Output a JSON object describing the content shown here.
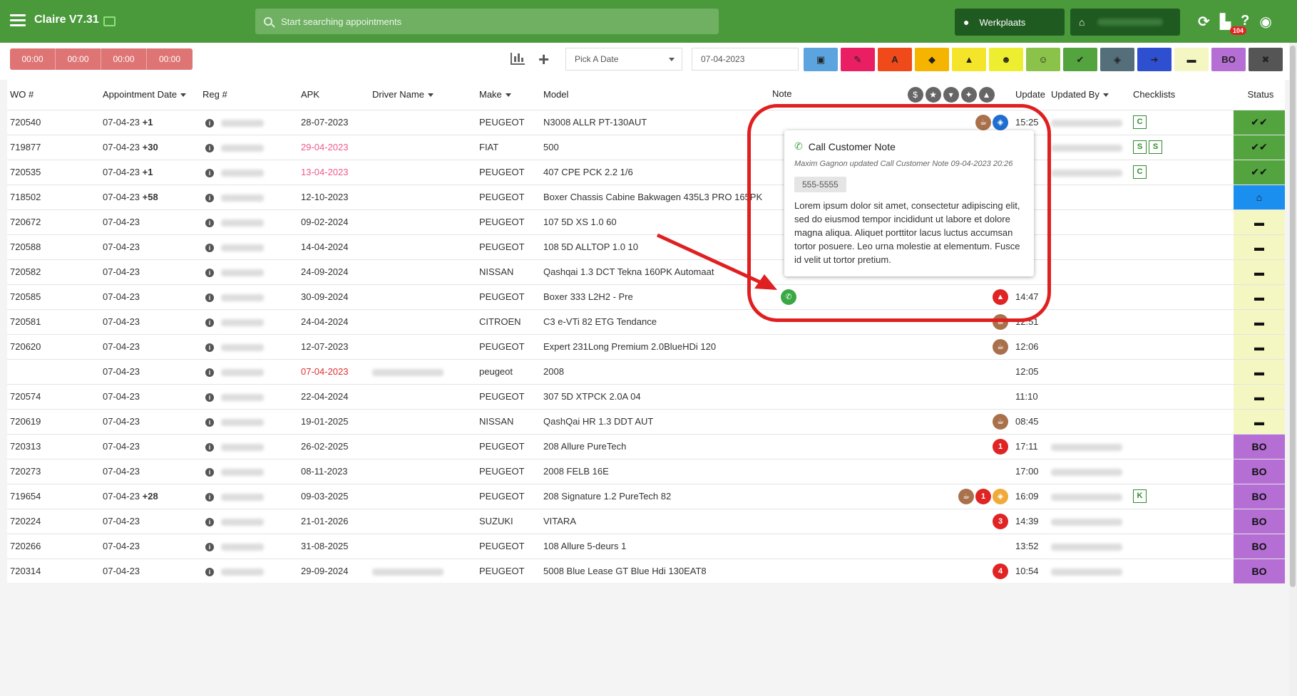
{
  "app": {
    "title": "Claire V7.31"
  },
  "search": {
    "placeholder": "Start searching appointments"
  },
  "location": {
    "label": "Werkplaats"
  },
  "badges": {
    "notifications": "104"
  },
  "timers": [
    "00:00",
    "00:00",
    "00:00",
    "00:00"
  ],
  "toolbar": {
    "pick_date_label": "Pick A Date",
    "date_value": "07-04-2023"
  },
  "filters": [
    {
      "icon": "calendar-icon",
      "glyph": "▣",
      "color": "#5ba4e0"
    },
    {
      "icon": "wrench-icon",
      "glyph": "✎",
      "color": "#e91e63"
    },
    {
      "icon": "font-a-icon",
      "glyph": "A",
      "color": "#f04a1a"
    },
    {
      "icon": "tag-icon",
      "glyph": "◆",
      "color": "#f4b400"
    },
    {
      "icon": "warning-icon",
      "glyph": "▲",
      "color": "#f5e52a"
    },
    {
      "icon": "user-check-icon",
      "glyph": "☻",
      "color": "#eeee30"
    },
    {
      "icon": "smile-icon",
      "glyph": "☺",
      "color": "#8bc34a"
    },
    {
      "icon": "double-check-icon",
      "glyph": "✔",
      "color": "#53a43f"
    },
    {
      "icon": "shield-icon",
      "glyph": "◈",
      "color": "#546e7a"
    },
    {
      "icon": "sign-out-icon",
      "glyph": "➜",
      "color": "#2e4fd0"
    },
    {
      "icon": "car-icon",
      "glyph": "▬",
      "color": "#f4f7c2"
    },
    {
      "icon": "bo-label",
      "glyph": "BO",
      "color": "#b46ed4"
    },
    {
      "icon": "close-circle-icon",
      "glyph": "✖",
      "color": "#555555"
    }
  ],
  "columns": {
    "wo": "WO #",
    "appointment_date": "Appointment Date",
    "reg": "Reg #",
    "apk": "APK",
    "driver": "Driver Name",
    "make": "Make",
    "model": "Model",
    "note": "Note",
    "update": "Update",
    "updated_by": "Updated By",
    "checklists": "Checklists",
    "status": "Status"
  },
  "rows": [
    {
      "wo": "720540",
      "date": "07-04-23",
      "plus": "+1",
      "apk": "28-07-2023",
      "apk_color": "",
      "make": "PEUGEOT",
      "model": "N3008 ALLR PT-130AUT",
      "update": "15:25",
      "checklists": [
        "C"
      ],
      "status": "check",
      "status_class": "st-green",
      "note_icons": [
        {
          "c": "brown",
          "t": "☕"
        },
        {
          "c": "blue",
          "t": "◈"
        }
      ],
      "updated_by_blur": true,
      "driver_blur": false
    },
    {
      "wo": "719877",
      "date": "07-04-23",
      "plus": "+30",
      "apk": "29-04-2023",
      "apk_color": "pink",
      "make": "FIAT",
      "model": "500",
      "update": "",
      "checklists": [
        "S",
        "S"
      ],
      "status": "check",
      "status_class": "st-green",
      "note_icons": [],
      "updated_by_blur": true,
      "driver_blur": false
    },
    {
      "wo": "720535",
      "date": "07-04-23",
      "plus": "+1",
      "apk": "13-04-2023",
      "apk_color": "pink",
      "make": "PEUGEOT",
      "model": "407 CPE PCK 2.2 1/6",
      "update": "",
      "checklists": [
        "C"
      ],
      "status": "check",
      "status_class": "st-green",
      "note_icons": [],
      "updated_by_blur": true,
      "driver_blur": false
    },
    {
      "wo": "718502",
      "date": "07-04-23",
      "plus": "+58",
      "apk": "12-10-2023",
      "apk_color": "",
      "make": "PEUGEOT",
      "model": "Boxer Chassis Cabine Bakwagen 435L3 PRO 165PK",
      "update": "",
      "checklists": [],
      "status": "garage",
      "status_class": "st-blue",
      "note_icons": [],
      "updated_by_blur": false,
      "driver_blur": false
    },
    {
      "wo": "720672",
      "date": "07-04-23",
      "plus": "",
      "apk": "09-02-2024",
      "apk_color": "",
      "make": "PEUGEOT",
      "model": "107 5D XS 1.0 60",
      "update": "",
      "checklists": [],
      "status": "car",
      "status_class": "st-yellow",
      "note_icons": [],
      "updated_by_blur": false,
      "driver_blur": false
    },
    {
      "wo": "720588",
      "date": "07-04-23",
      "plus": "",
      "apk": "14-04-2024",
      "apk_color": "",
      "make": "PEUGEOT",
      "model": "108 5D ALLTOP 1.0 10",
      "update": "",
      "checklists": [],
      "status": "car",
      "status_class": "st-yellow",
      "note_icons": [],
      "updated_by_blur": false,
      "driver_blur": false
    },
    {
      "wo": "720582",
      "date": "07-04-23",
      "plus": "",
      "apk": "24-09-2024",
      "apk_color": "",
      "make": "NISSAN",
      "model": "Qashqai 1.3 DCT Tekna 160PK Automaat",
      "update": "",
      "checklists": [],
      "status": "car",
      "status_class": "st-yellow",
      "note_icons": [],
      "updated_by_blur": false,
      "driver_blur": false
    },
    {
      "wo": "720585",
      "date": "07-04-23",
      "plus": "",
      "apk": "30-09-2024",
      "apk_color": "",
      "make": "PEUGEOT",
      "model": "Boxer 333 L2H2 - Pre",
      "update": "14:47",
      "checklists": [],
      "status": "car",
      "status_class": "st-yellow",
      "note_icons": [
        {
          "c": "red",
          "t": "▲"
        }
      ],
      "updated_by_blur": false,
      "driver_blur": false,
      "phone": true
    },
    {
      "wo": "720581",
      "date": "07-04-23",
      "plus": "",
      "apk": "24-04-2024",
      "apk_color": "",
      "make": "CITROEN",
      "model": "C3 e-VTi 82 ETG Tendance",
      "update": "12:51",
      "checklists": [],
      "status": "car",
      "status_class": "st-yellow",
      "note_icons": [
        {
          "c": "brown",
          "t": "☕"
        }
      ],
      "updated_by_blur": false,
      "driver_blur": false
    },
    {
      "wo": "720620",
      "date": "07-04-23",
      "plus": "",
      "apk": "12-07-2023",
      "apk_color": "",
      "make": "PEUGEOT",
      "model": "Expert 231Long Premium 2.0BlueHDi 120",
      "update": "12:06",
      "checklists": [],
      "status": "car",
      "status_class": "st-yellow",
      "note_icons": [
        {
          "c": "brown",
          "t": "☕"
        }
      ],
      "updated_by_blur": false,
      "driver_blur": false
    },
    {
      "wo": "",
      "date": "07-04-23",
      "plus": "",
      "apk": "07-04-2023",
      "apk_color": "red",
      "make": "peugeot",
      "model": "2008",
      "update": "12:05",
      "checklists": [],
      "status": "car",
      "status_class": "st-yellow",
      "note_icons": [],
      "updated_by_blur": false,
      "driver_blur": true
    },
    {
      "wo": "720574",
      "date": "07-04-23",
      "plus": "",
      "apk": "22-04-2024",
      "apk_color": "",
      "make": "PEUGEOT",
      "model": "307 5D XTPCK 2.0A 04",
      "update": "11:10",
      "checklists": [],
      "status": "car",
      "status_class": "st-yellow",
      "note_icons": [],
      "updated_by_blur": false,
      "driver_blur": false
    },
    {
      "wo": "720619",
      "date": "07-04-23",
      "plus": "",
      "apk": "19-01-2025",
      "apk_color": "",
      "make": "NISSAN",
      "model": "QashQai HR 1.3 DDT AUT",
      "update": "08:45",
      "checklists": [],
      "status": "car",
      "status_class": "st-yellow",
      "note_icons": [
        {
          "c": "brown",
          "t": "☕"
        }
      ],
      "updated_by_blur": false,
      "driver_blur": false
    },
    {
      "wo": "720313",
      "date": "07-04-23",
      "plus": "",
      "apk": "26-02-2025",
      "apk_color": "",
      "make": "PEUGEOT",
      "model": "208 Allure PureTech",
      "update": "17:11",
      "checklists": [],
      "status": "BO",
      "status_class": "st-purple",
      "note_icons": [
        {
          "c": "red",
          "t": "1"
        }
      ],
      "updated_by_blur": true,
      "driver_blur": false
    },
    {
      "wo": "720273",
      "date": "07-04-23",
      "plus": "",
      "apk": "08-11-2023",
      "apk_color": "",
      "make": "PEUGEOT",
      "model": "2008 FELB 16E",
      "update": "17:00",
      "checklists": [],
      "status": "BO",
      "status_class": "st-purple",
      "note_icons": [],
      "updated_by_blur": true,
      "driver_blur": false
    },
    {
      "wo": "719654",
      "date": "07-04-23",
      "plus": "+28",
      "apk": "09-03-2025",
      "apk_color": "",
      "make": "PEUGEOT",
      "model": "208 Signature 1.2 PureTech 82",
      "update": "16:09",
      "checklists": [
        "K"
      ],
      "status": "BO",
      "status_class": "st-purple",
      "note_icons": [
        {
          "c": "brown",
          "t": "☕"
        },
        {
          "c": "red",
          "t": "1"
        },
        {
          "c": "orange",
          "t": "◈"
        }
      ],
      "updated_by_blur": true,
      "driver_blur": false
    },
    {
      "wo": "720224",
      "date": "07-04-23",
      "plus": "",
      "apk": "21-01-2026",
      "apk_color": "",
      "make": "SUZUKI",
      "model": "VITARA",
      "update": "14:39",
      "checklists": [],
      "status": "BO",
      "status_class": "st-purple",
      "note_icons": [
        {
          "c": "red",
          "t": "3"
        }
      ],
      "updated_by_blur": true,
      "driver_blur": false
    },
    {
      "wo": "720266",
      "date": "07-04-23",
      "plus": "",
      "apk": "31-08-2025",
      "apk_color": "",
      "make": "PEUGEOT",
      "model": "108 Allure 5-deurs 1",
      "update": "13:52",
      "checklists": [],
      "status": "BO",
      "status_class": "st-purple",
      "note_icons": [],
      "updated_by_blur": true,
      "driver_blur": false
    },
    {
      "wo": "720314",
      "date": "07-04-23",
      "plus": "",
      "apk": "29-09-2024",
      "apk_color": "",
      "make": "PEUGEOT",
      "model": "5008 Blue Lease GT Blue Hdi 130EAT8",
      "update": "10:54",
      "checklists": [],
      "status": "BO",
      "status_class": "st-purple",
      "note_icons": [
        {
          "c": "red",
          "t": "4"
        }
      ],
      "updated_by_blur": true,
      "driver_blur": true
    }
  ],
  "popup": {
    "title": "Call Customer Note",
    "meta": "Maxim Gagnon updated Call Customer Note 09-04-2023 20:26",
    "phone": "555-5555",
    "body": "Lorem ipsum dolor sit amet, consectetur adipiscing elit, sed do eiusmod tempor incididunt ut labore et dolore magna aliqua. Aliquet porttitor lacus luctus accumsan tortor posuere. Leo urna molestie at elementum. Fusce id velit ut tortor pretium."
  }
}
